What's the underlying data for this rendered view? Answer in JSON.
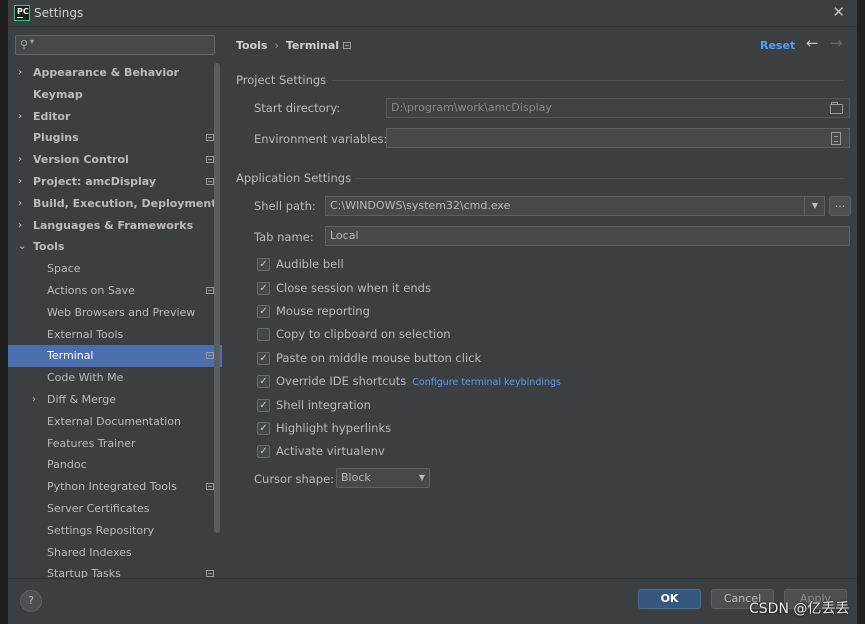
{
  "window": {
    "title": "Settings"
  },
  "sidebar": {
    "search_placeholder": "",
    "items": [
      {
        "label": "Appearance & Behavior"
      },
      {
        "label": "Keymap"
      },
      {
        "label": "Editor"
      },
      {
        "label": "Plugins"
      },
      {
        "label": "Version Control"
      },
      {
        "label": "Project: amcDisplay"
      },
      {
        "label": "Build, Execution, Deployment"
      },
      {
        "label": "Languages & Frameworks"
      },
      {
        "label": "Tools"
      },
      {
        "label": "Space"
      },
      {
        "label": "Actions on Save"
      },
      {
        "label": "Web Browsers and Preview"
      },
      {
        "label": "External Tools"
      },
      {
        "label": "Terminal"
      },
      {
        "label": "Code With Me"
      },
      {
        "label": "Diff & Merge"
      },
      {
        "label": "External Documentation"
      },
      {
        "label": "Features Trainer"
      },
      {
        "label": "Pandoc"
      },
      {
        "label": "Python Integrated Tools"
      },
      {
        "label": "Server Certificates"
      },
      {
        "label": "Settings Repository"
      },
      {
        "label": "Shared Indexes"
      },
      {
        "label": "Startup Tasks"
      }
    ]
  },
  "breadcrumb": {
    "parent": "Tools",
    "current": "Terminal"
  },
  "header": {
    "reset": "Reset"
  },
  "project_settings": {
    "title": "Project Settings",
    "start_directory_label": "Start directory:",
    "start_directory_value": "D:\\program\\work\\amcDisplay",
    "env_vars_label": "Environment variables:",
    "env_vars_value": ""
  },
  "application_settings": {
    "title": "Application Settings",
    "shell_path_label": "Shell path:",
    "shell_path_value": "C:\\WINDOWS\\system32\\cmd.exe",
    "browse_label": "...",
    "tab_name_label": "Tab name:",
    "tab_name_value": "Local",
    "checkboxes": [
      {
        "label": "Audible bell",
        "checked": true
      },
      {
        "label": "Close session when it ends",
        "checked": true
      },
      {
        "label": "Mouse reporting",
        "checked": true
      },
      {
        "label": "Copy to clipboard on selection",
        "checked": false
      },
      {
        "label": "Paste on middle mouse button click",
        "checked": true
      },
      {
        "label": "Override IDE shortcuts",
        "checked": true,
        "link": "Configure terminal keybindings"
      },
      {
        "label": "Shell integration",
        "checked": true
      },
      {
        "label": "Highlight hyperlinks",
        "checked": true
      },
      {
        "label": "Activate virtualenv",
        "checked": true
      }
    ],
    "cursor_shape_label": "Cursor shape:",
    "cursor_shape_value": "Block"
  },
  "footer": {
    "help": "?",
    "ok": "OK",
    "cancel": "Cancel",
    "apply": "Apply"
  },
  "watermark": "CSDN @亿丢丢",
  "colors": {
    "selection": "#4b6eaf",
    "link": "#589df6",
    "primary_button": "#365880"
  }
}
